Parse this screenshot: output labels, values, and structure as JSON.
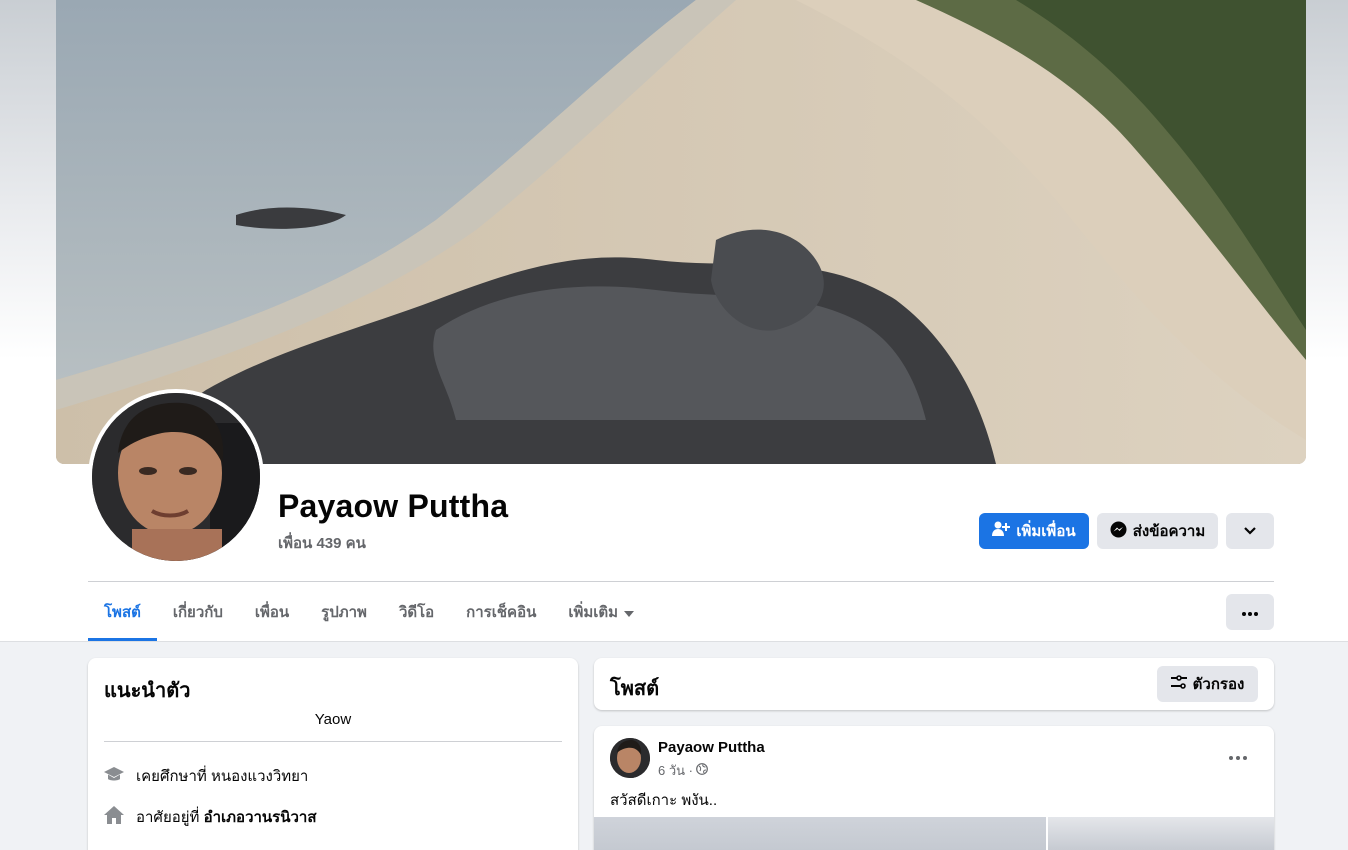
{
  "profile": {
    "name": "Payaow Puttha",
    "friends_label": "เพื่อน 439 คน"
  },
  "actions": {
    "add_friend": "เพิ่มเพื่อน",
    "message": "ส่งข้อความ"
  },
  "tabs": [
    {
      "label": "โพสต์",
      "active": true
    },
    {
      "label": "เกี่ยวกับ"
    },
    {
      "label": "เพื่อน"
    },
    {
      "label": "รูปภาพ"
    },
    {
      "label": "วิดีโอ"
    },
    {
      "label": "การเช็คอิน"
    },
    {
      "label": "เพิ่มเติม"
    }
  ],
  "intro": {
    "title": "แนะนำตัว",
    "bio": "Yaow",
    "education_prefix": "เคยศึกษาที่",
    "education_place": "หนองแวงวิทยา",
    "home_prefix": "อาศัยอยู่ที่",
    "home_place": "อำเภอวานรนิวาส"
  },
  "posts_section": {
    "title": "โพสต์",
    "filter_label": "ตัวกรอง"
  },
  "post": {
    "author": "Payaow Puttha",
    "time": "6 วัน ·",
    "text": "สวัสดีเกาะ พงัน.."
  },
  "colors": {
    "accent": "#1b74e4",
    "secondary_button": "#e4e6eb",
    "muted_text": "#65676b"
  }
}
